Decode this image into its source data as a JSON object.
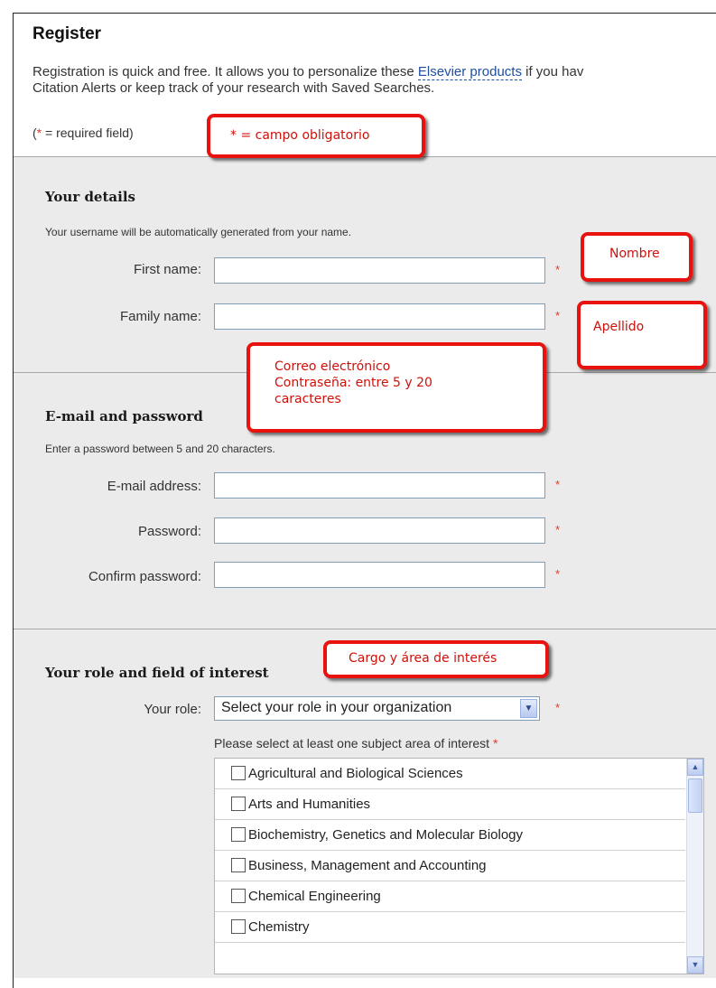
{
  "header": {
    "title": "Register",
    "intro_line1_prefix": "Registration is quick and free. It allows you to personalize these ",
    "intro_link": "Elsevier products",
    "intro_line1_suffix": " if you hav",
    "intro_line2": "Citation Alerts or keep track of your research with Saved Searches.",
    "required_note_open": "(",
    "required_note_star": "*",
    "required_note_rest": " = required field)"
  },
  "details": {
    "title": "Your details",
    "hint": "Your username will be automatically generated from your name.",
    "first_name_label": "First name:",
    "family_name_label": "Family name:",
    "required_marker": "*"
  },
  "email_password": {
    "title": "E-mail and password",
    "hint": "Enter a password between 5 and 20 characters.",
    "email_label": "E-mail address:",
    "password_label": "Password:",
    "confirm_label": "Confirm password:"
  },
  "role": {
    "title": "Your role and field of interest",
    "role_label": "Your role:",
    "role_selected": "Select your role in your organization",
    "subject_prompt": "Please select at least one subject area of interest",
    "subjects": [
      "Agricultural and Biological Sciences",
      "Arts and Humanities",
      "Biochemistry, Genetics and Molecular Biology",
      "Business, Management and Accounting",
      "Chemical Engineering",
      "Chemistry"
    ]
  },
  "callouts": {
    "required": "* = campo obligatorio",
    "first_name": "Nombre",
    "family_name": "Apellido",
    "email_line1": "Correo electrónico",
    "email_line2": "Contraseña: entre 5 y 20",
    "email_line3": "caracteres",
    "role": "Cargo y área de interés"
  },
  "icons": {
    "select_arrow": "chevron-down-icon",
    "scroll_up": "arrow-up-icon",
    "scroll_down": "arrow-down-icon"
  },
  "colors": {
    "required_star": "#e03a2a",
    "callout_border": "#e8130f",
    "link": "#1f4fa0",
    "panel_bg": "#ebebeb"
  }
}
